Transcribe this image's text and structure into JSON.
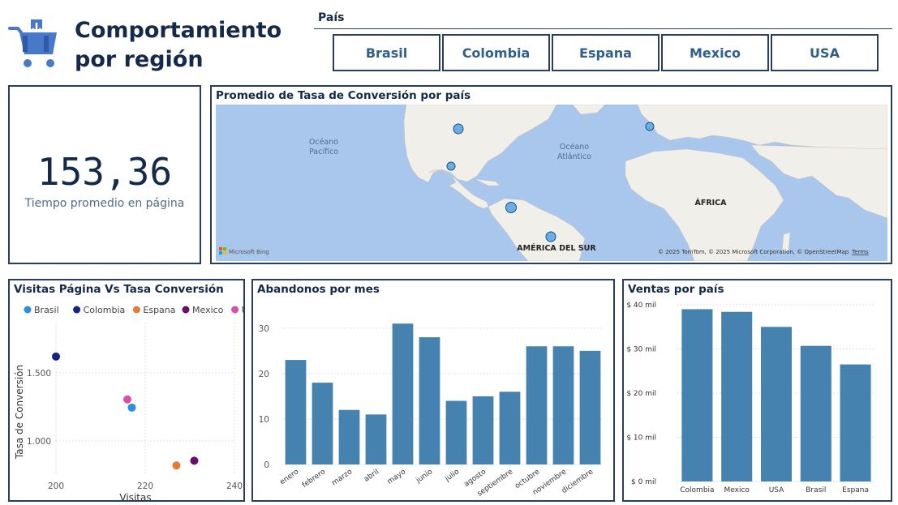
{
  "header": {
    "title_line1": "Comportamiento",
    "title_line2": "por región"
  },
  "slicer": {
    "title": "País",
    "options": [
      "Brasil",
      "Colombia",
      "Espana",
      "Mexico",
      "USA"
    ]
  },
  "kpi": {
    "value": "153,36",
    "label": "Tiempo promedio en página"
  },
  "map": {
    "title": "Promedio de Tasa de Conversión por país",
    "labels": {
      "pacific": [
        "Océano",
        "Pacífico"
      ],
      "atlantic": [
        "Océano",
        "Atlántico"
      ],
      "africa": "ÁFRICA",
      "south_america": "AMÉRICA DEL SUR"
    },
    "attribution": "© 2025 TomTom, © 2025 Microsoft Corporation, © OpenStreetMap",
    "terms": "Terms",
    "bing": "Microsoft Bing",
    "colors": {
      "water": "#a9c6ec",
      "land": "#f1efea",
      "marker": "#6aaee8"
    }
  },
  "scatter": {
    "title": "Visitas Página Vs Tasa Conversión",
    "xlabel": "Visitas",
    "ylabel": "Tasa de Conversión",
    "legend": [
      {
        "name": "Brasil",
        "color": "#2e8ee0"
      },
      {
        "name": "Colombia",
        "color": "#12248c"
      },
      {
        "name": "Espana",
        "color": "#e37a3a"
      },
      {
        "name": "Mexico",
        "color": "#6a0e6e"
      },
      {
        "name": "USA",
        "color": "#d84fae"
      }
    ]
  },
  "abandonos": {
    "title": "Abandonos por mes"
  },
  "ventas": {
    "title": "Ventas por país"
  },
  "chart_data": [
    {
      "type": "scatter",
      "title": "Visitas Página Vs Tasa Conversión",
      "xlabel": "Visitas",
      "ylabel": "Tasa de Conversión",
      "xlim": [
        200,
        240
      ],
      "ylim": [
        750,
        1750
      ],
      "xticks": [
        "200",
        "220",
        "240"
      ],
      "yticks": [
        "1.000",
        "1.500"
      ],
      "ytick_values": [
        1000,
        1500
      ],
      "xtick_values": [
        200,
        220,
        240
      ],
      "series": [
        {
          "name": "Brasil",
          "x": [
            217
          ],
          "y": [
            1245
          ]
        },
        {
          "name": "Colombia",
          "x": [
            200
          ],
          "y": [
            1620
          ]
        },
        {
          "name": "Espana",
          "x": [
            227
          ],
          "y": [
            820
          ]
        },
        {
          "name": "Mexico",
          "x": [
            231
          ],
          "y": [
            855
          ]
        },
        {
          "name": "USA",
          "x": [
            216
          ],
          "y": [
            1305
          ]
        }
      ],
      "legend": "top"
    },
    {
      "type": "bar",
      "title": "Abandonos por mes",
      "categories": [
        "enero",
        "febrero",
        "marzo",
        "abril",
        "mayo",
        "junio",
        "julio",
        "agosto",
        "septiembre",
        "octubre",
        "noviembre",
        "diciembre"
      ],
      "values": [
        23,
        18,
        12,
        11,
        31,
        28,
        14,
        15,
        16,
        26,
        26,
        25
      ],
      "ylim": [
        0,
        33
      ],
      "yticks": [
        "0",
        "10",
        "20",
        "30"
      ],
      "ytick_values": [
        0,
        10,
        20,
        30
      ],
      "color": "#4682b0"
    },
    {
      "type": "bar",
      "title": "Ventas por país",
      "categories": [
        "Colombia",
        "Mexico",
        "USA",
        "Brasil",
        "Espana"
      ],
      "values": [
        39,
        38.4,
        35,
        30.7,
        26.5
      ],
      "ylim": [
        0,
        40
      ],
      "yticks": [
        "$ 0 mil",
        "$ 10 mil",
        "$ 20 mil",
        "$ 30 mil",
        "$ 40 mil"
      ],
      "ytick_values": [
        0,
        10,
        20,
        30,
        40
      ],
      "color": "#4682b0"
    }
  ]
}
